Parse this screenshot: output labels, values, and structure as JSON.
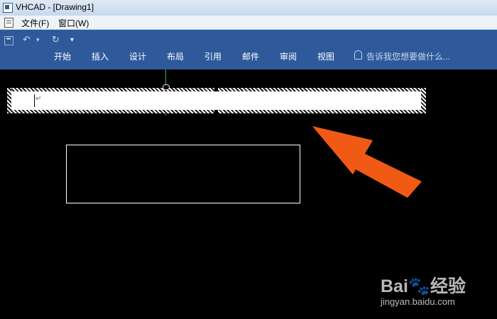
{
  "window": {
    "title": "VHCAD - [Drawing1]"
  },
  "menubar": {
    "items": [
      "文件(F)",
      "窗口(W)"
    ]
  },
  "quick_access": {
    "save_icon": "save-icon",
    "undo_icon": "undo-icon",
    "redo_icon": "redo-icon",
    "customize_glyph": "▾"
  },
  "ribbon": {
    "tabs": [
      "开始",
      "插入",
      "设计",
      "布局",
      "引用",
      "邮件",
      "审阅",
      "视图"
    ],
    "tell_me_placeholder": "告诉我您想要做什么...",
    "background_color": "#2e5a9b"
  },
  "canvas": {
    "background_color": "#000000",
    "text_box": {
      "paragraph_mark": "↵"
    }
  },
  "watermark": {
    "brand": "Bai🐾经验",
    "url": "jingyan.baidu.com"
  },
  "annotation": {
    "arrow_color": "#f05a14"
  }
}
